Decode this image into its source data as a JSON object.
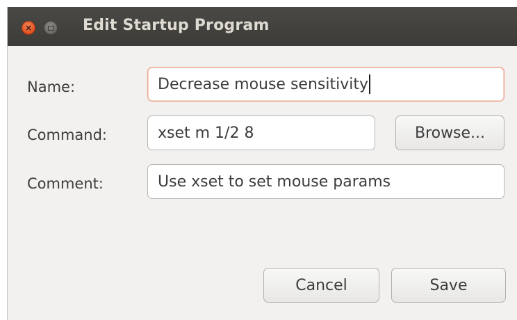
{
  "window": {
    "title": "Edit Startup Program",
    "close_symbol": "×"
  },
  "form": {
    "name": {
      "label": "Name:",
      "value": "Decrease mouse sensitivity"
    },
    "command": {
      "label": "Command:",
      "value": "xset m 1/2 8",
      "browse_label": "Browse..."
    },
    "comment": {
      "label": "Comment:",
      "value": "Use xset to set mouse params"
    }
  },
  "actions": {
    "cancel_label": "Cancel",
    "save_label": "Save"
  },
  "colors": {
    "titlebar": "#3c3b37",
    "close_button": "#e0501f",
    "window_background": "#f2f1f0",
    "focus_border": "#e8a08a"
  },
  "icons": {
    "close": "close-icon",
    "minimize": "minimize-icon"
  }
}
